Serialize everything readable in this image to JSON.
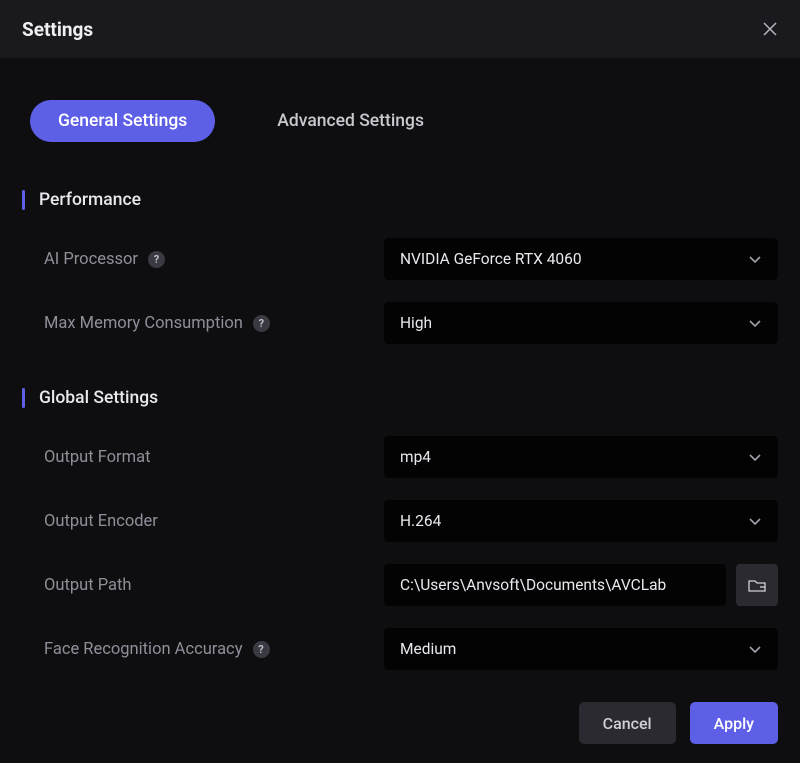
{
  "header": {
    "title": "Settings"
  },
  "tabs": {
    "general": "General Settings",
    "advanced": "Advanced Settings"
  },
  "sections": {
    "performance": {
      "title": "Performance",
      "ai_processor_label": "AI Processor",
      "ai_processor_value": "NVIDIA GeForce RTX 4060",
      "max_memory_label": "Max Memory Consumption",
      "max_memory_value": "High"
    },
    "global": {
      "title": "Global Settings",
      "output_format_label": "Output Format",
      "output_format_value": "mp4",
      "output_encoder_label": "Output Encoder",
      "output_encoder_value": "H.264",
      "output_path_label": "Output Path",
      "output_path_value": "C:\\Users\\Anvsoft\\Documents\\AVCLab",
      "face_recog_label": "Face Recognition Accuracy",
      "face_recog_value": "Medium"
    }
  },
  "buttons": {
    "cancel": "Cancel",
    "apply": "Apply"
  }
}
